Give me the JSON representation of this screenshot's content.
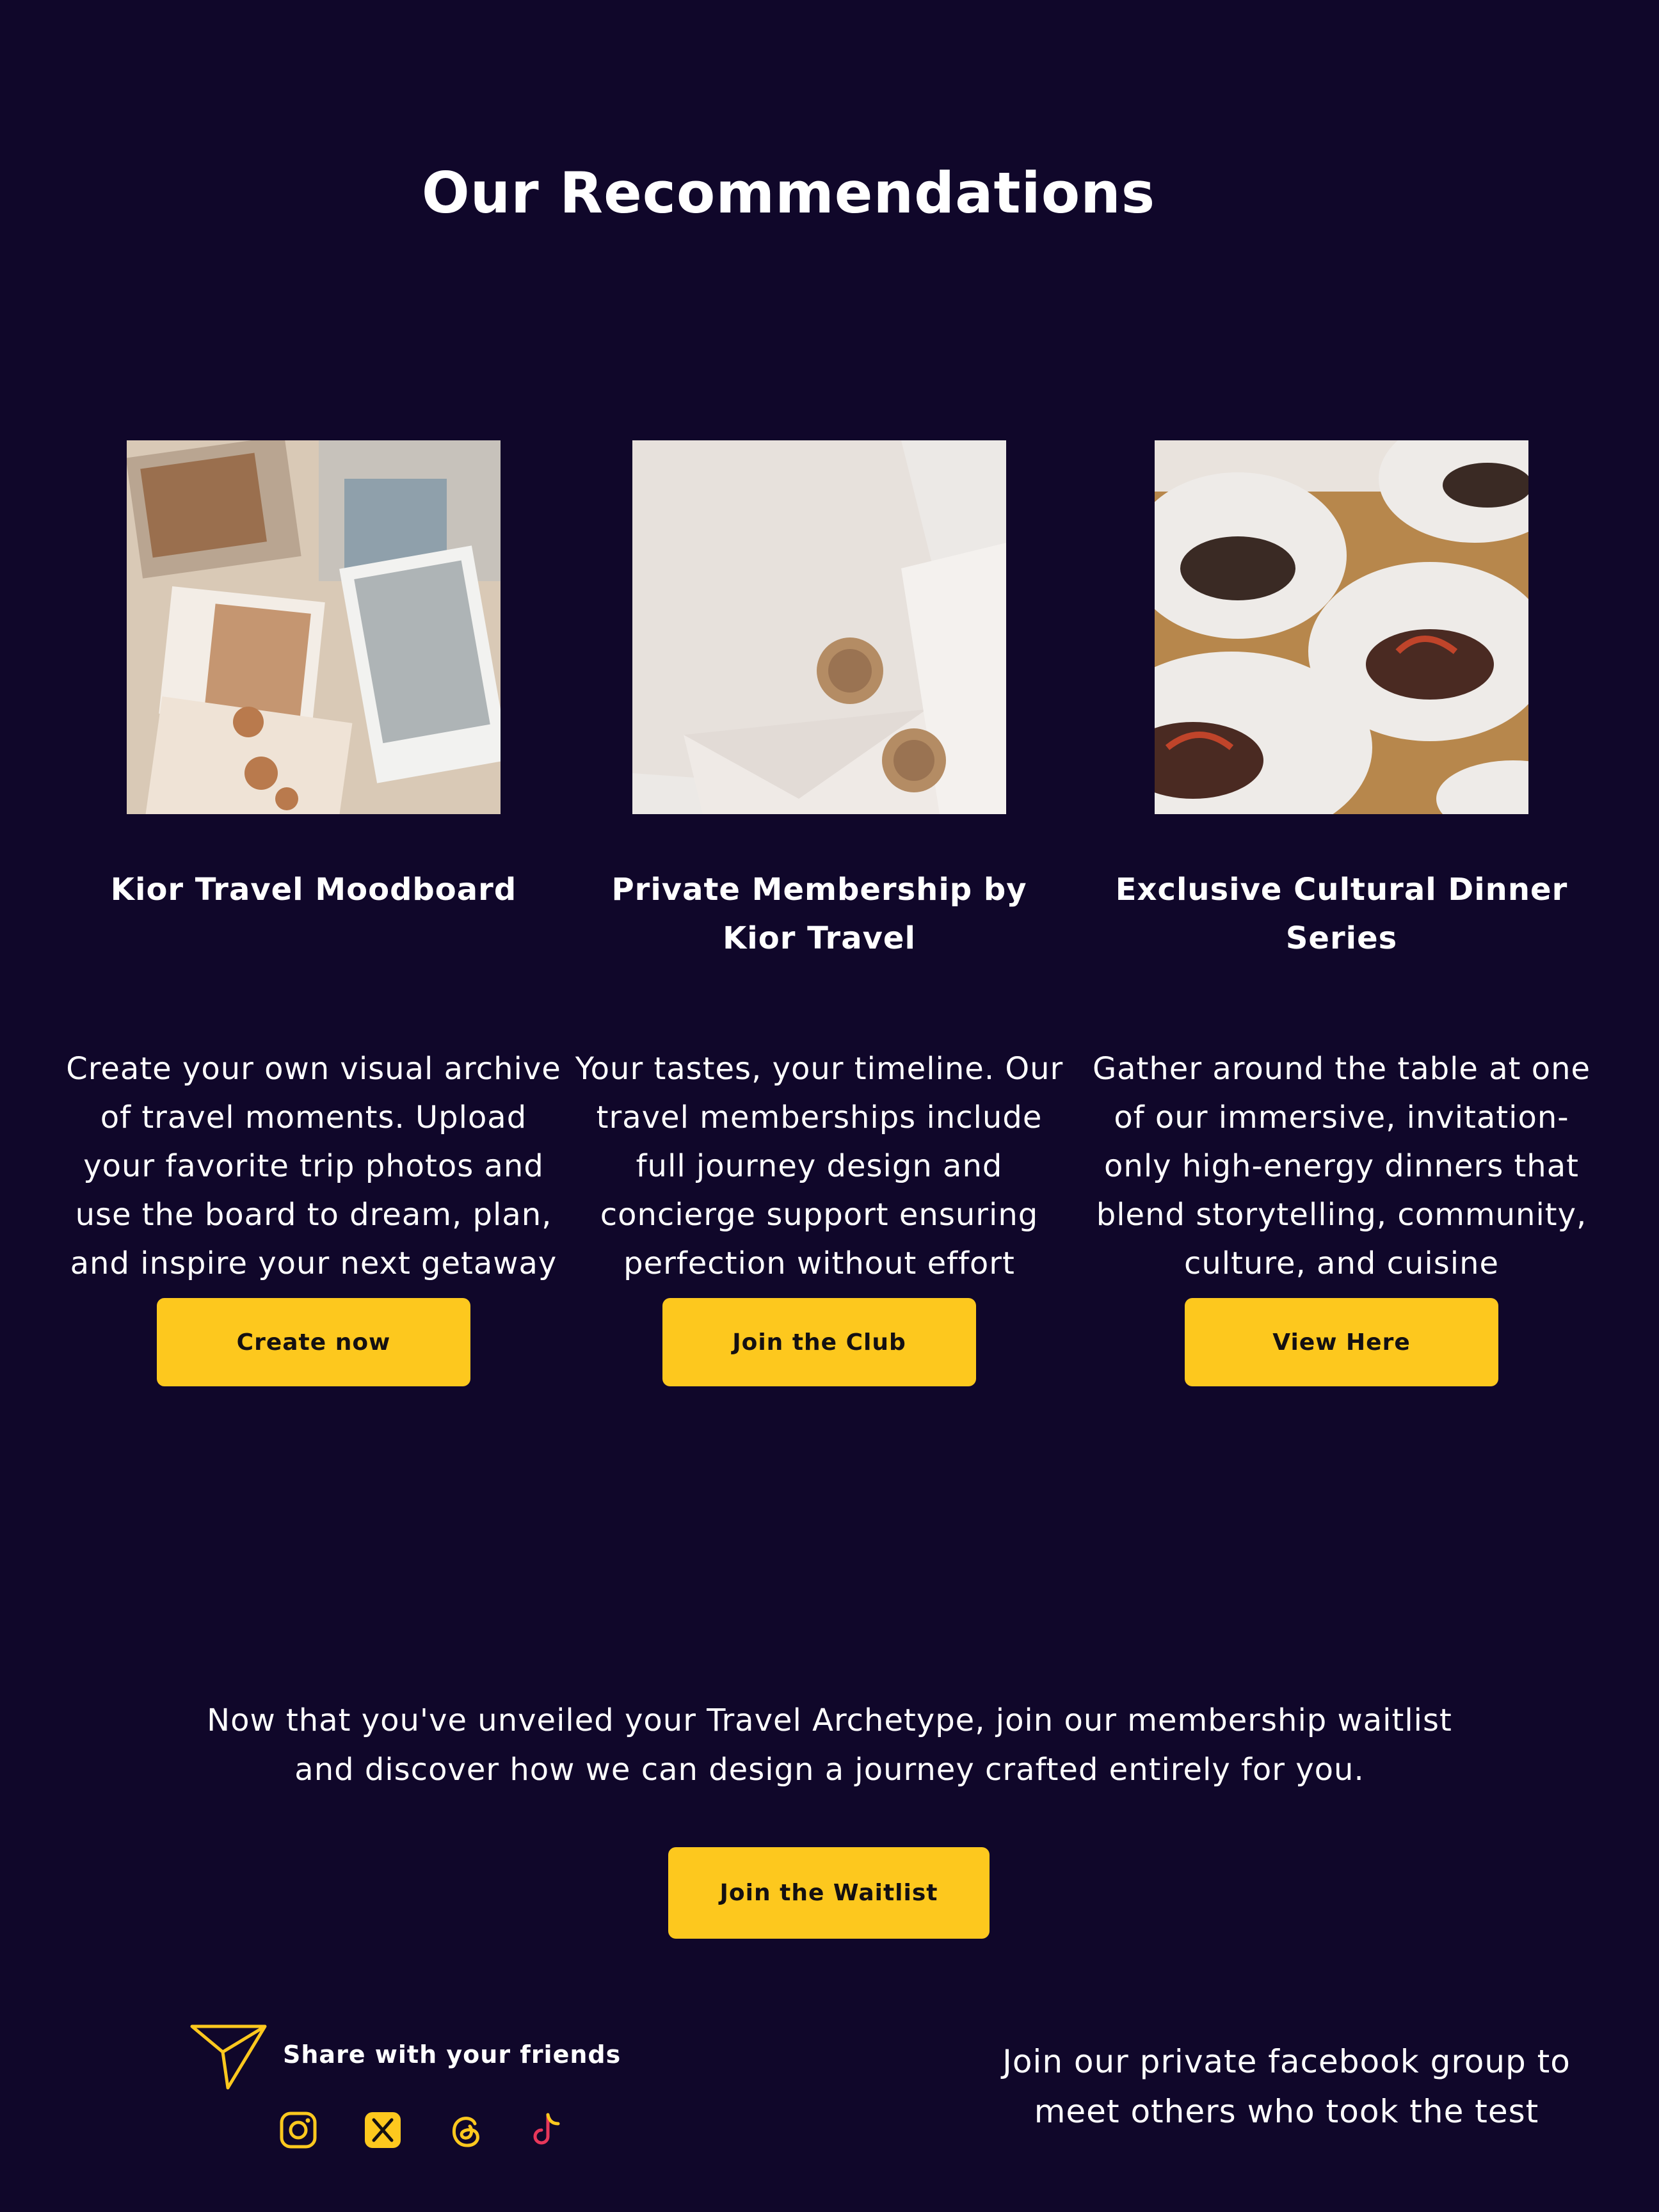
{
  "page": {
    "title": "Our Recommendations"
  },
  "cards": [
    {
      "image": "travel-moodboard-photo",
      "title": "Kior Travel Moodboard",
      "description": "Create your own visual archive of travel moments. Upload your favorite trip photos and use the board to dream, plan, and inspire your next getaway",
      "button": "Create now"
    },
    {
      "image": "wax-sealed-envelope-photo",
      "title": "Private Membership by Kior Travel",
      "description": "Your tastes, your timeline. Our travel memberships include full journey design and concierge support ensuring perfection without effort",
      "button": "Join the Club"
    },
    {
      "image": "lobster-dinner-bowls-photo",
      "title": "Exclusive Cultural Dinner Series",
      "description": "Gather around the table at one of our immersive, invitation-only high-energy dinners that blend storytelling, community, culture, and cuisine",
      "button": "View Here"
    }
  ],
  "cta": {
    "text": "Now that you've unveiled your Travel Archetype, join our membership waitlist and discover how we can design a journey crafted entirely for you.",
    "button": "Join the Waitlist"
  },
  "share": {
    "icon": "paper-plane-icon",
    "label": "Share with your friends",
    "socials": [
      "instagram-icon",
      "x-icon",
      "threads-icon",
      "tiktok-icon"
    ]
  },
  "facebook": {
    "text": "Join our private facebook group to meet others who took the test"
  },
  "colors": {
    "background": "#10072a",
    "accent": "#fdc81e",
    "text": "#ffffff"
  }
}
